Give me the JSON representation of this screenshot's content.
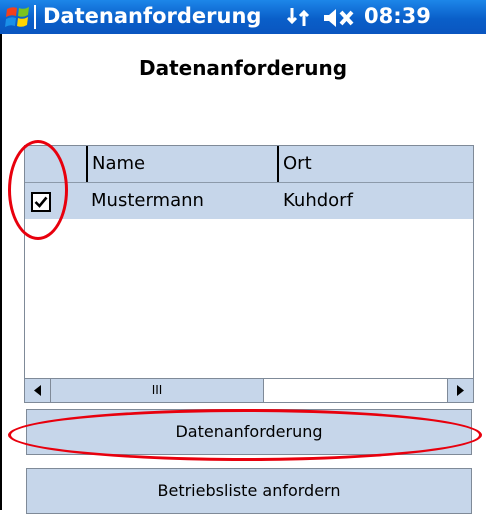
{
  "titlebar": {
    "title": "Datenanforderung",
    "time": "08:39"
  },
  "page": {
    "title": "Datenanforderung"
  },
  "grid": {
    "columns": [
      "Name",
      "Ort"
    ],
    "rows": [
      {
        "checked": true,
        "name": "Mustermann",
        "ort": "Kuhdorf"
      }
    ],
    "scrollbar_thumb_label": "III"
  },
  "buttons": {
    "request_data": "Datenanforderung",
    "request_farm_list": "Betriebsliste anfordern"
  },
  "colors": {
    "titlebar": "#0a5fc9",
    "grid_highlight": "#c6d6ea",
    "annotation": "#e8000d"
  },
  "icons": [
    "windows-logo-icon",
    "connectivity-icon",
    "volume-muted-icon",
    "checkbox-checked-icon",
    "scroll-left-icon",
    "scroll-right-icon"
  ]
}
